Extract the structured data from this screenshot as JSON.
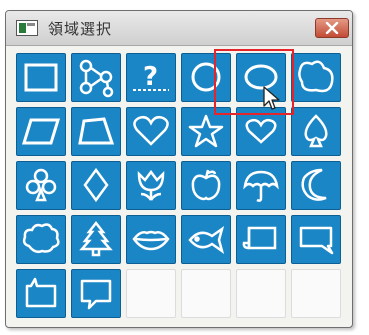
{
  "window": {
    "title": "領域選択",
    "icon": "window-app-icon",
    "close_icon": "close-icon"
  },
  "shapes": [
    "rectangle",
    "network",
    "unknown",
    "circle",
    "ellipse",
    "irregular",
    "parallelogram",
    "trapezoid",
    "heart",
    "star",
    "heart-small",
    "spade",
    "club",
    "diamond",
    "tulip",
    "apple",
    "umbrella",
    "crescent-moon",
    "cloud",
    "tree",
    "lips",
    "fish",
    "scroll-banner",
    "speech-bubble-right",
    "speech-bubble-left",
    "speech-bubble-rect",
    "empty",
    "empty",
    "empty",
    "empty"
  ],
  "selected_shape": "ellipse",
  "colors": {
    "tile": "#1b86c6",
    "highlight": "#e4262c",
    "close": "#c24c36"
  }
}
